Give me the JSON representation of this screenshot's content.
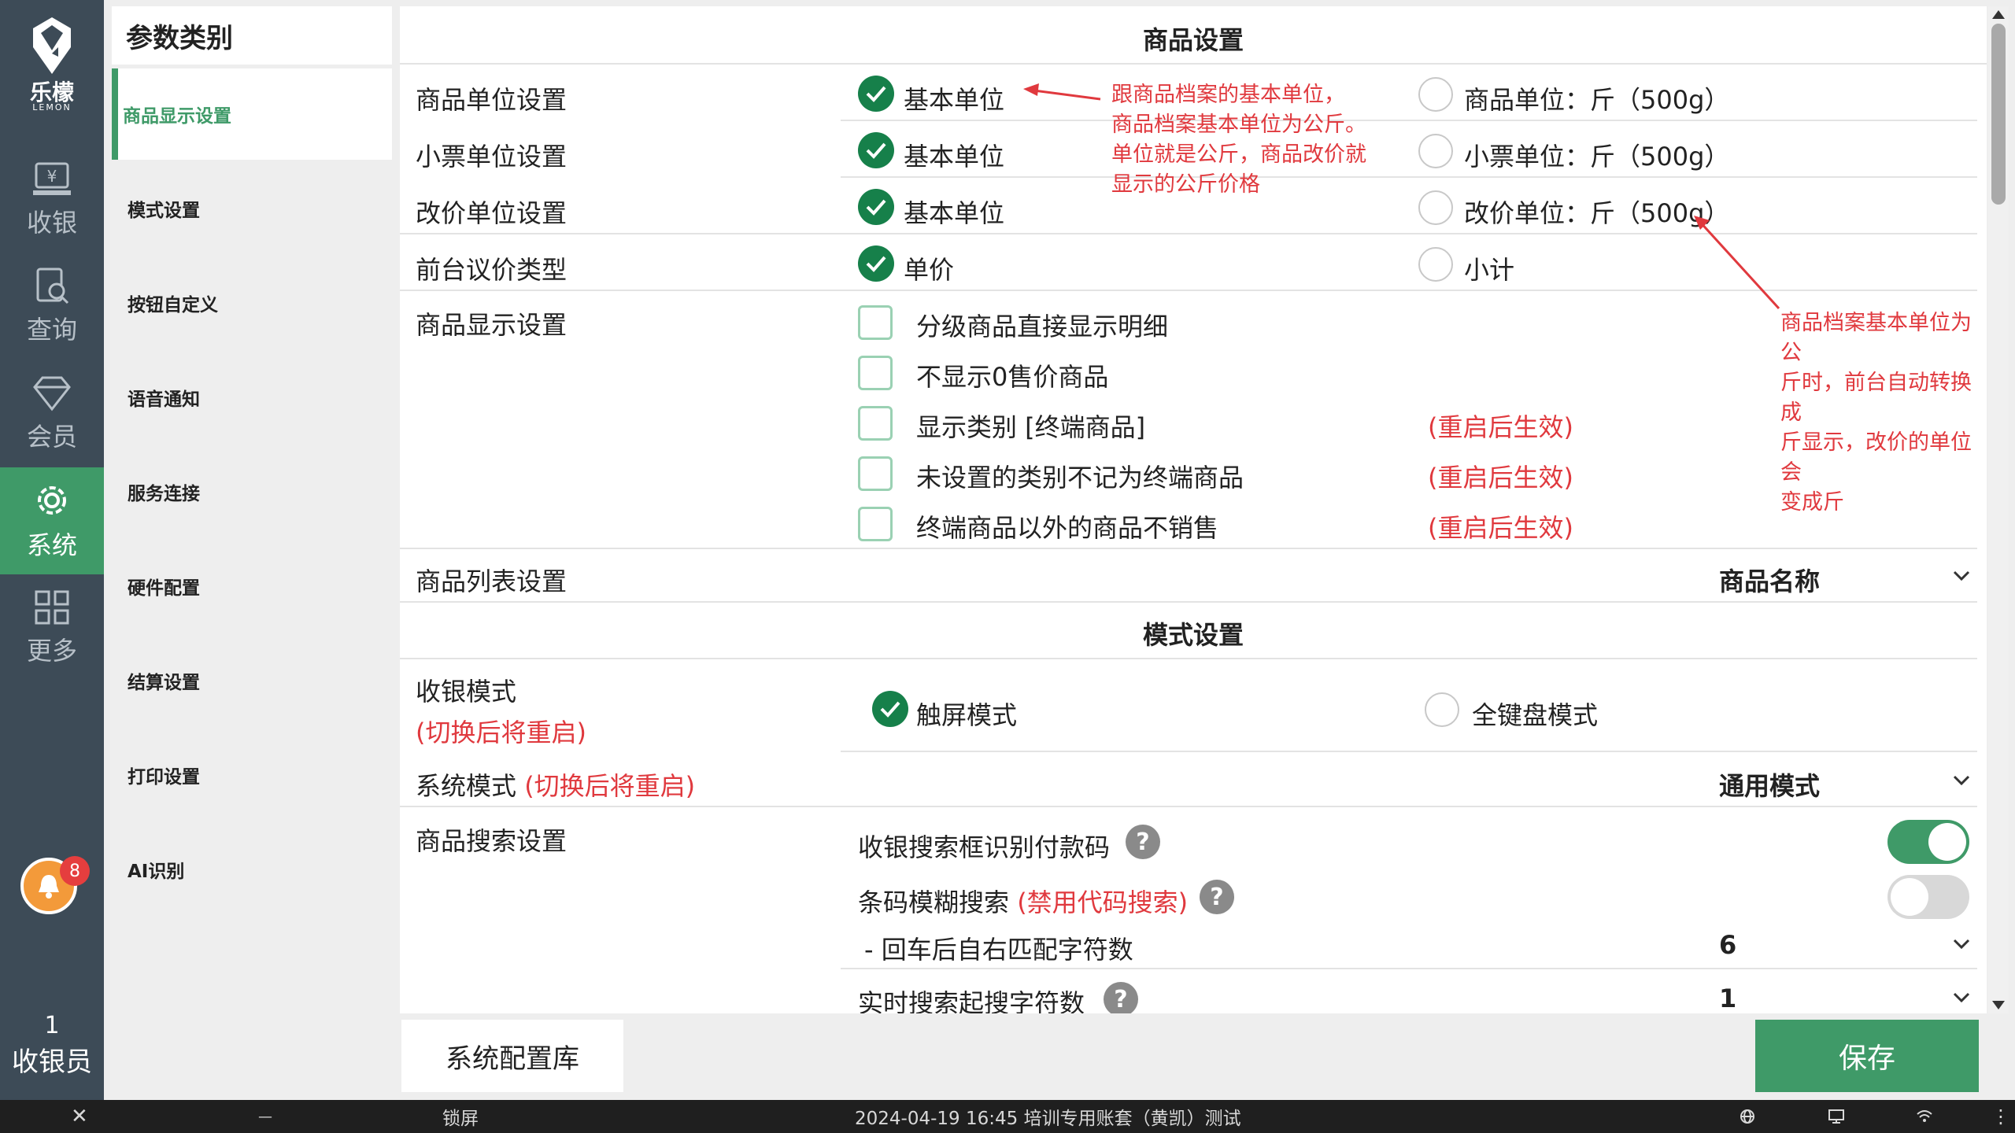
{
  "app": {
    "logo_cn": "乐檬",
    "logo_en": "LEMON"
  },
  "nav": {
    "items": [
      {
        "label": "收银",
        "icon": "cash-register-icon"
      },
      {
        "label": "查询",
        "icon": "search-doc-icon"
      },
      {
        "label": "会员",
        "icon": "diamond-icon"
      },
      {
        "label": "系统",
        "icon": "gear-icon"
      },
      {
        "label": "更多",
        "icon": "grid-icon"
      }
    ],
    "notify_count": "8",
    "user_number": "1",
    "user_role": "收银员"
  },
  "categories": {
    "header": "参数类别",
    "items": [
      "商品显示设置",
      "模式设置",
      "按钮自定义",
      "语音通知",
      "服务连接",
      "硬件配置",
      "结算设置",
      "打印设置",
      "AI识别"
    ]
  },
  "goods_section": {
    "title": "商品设置",
    "rows": [
      {
        "label": "商品单位设置",
        "opt1": "基本单位",
        "opt2": "商品单位：斤（500g）"
      },
      {
        "label": "小票单位设置",
        "opt1": "基本单位",
        "opt2": "小票单位：斤（500g）"
      },
      {
        "label": "改价单位设置",
        "opt1": "基本单位",
        "opt2": "改价单位：斤（500g）"
      },
      {
        "label": "前台议价类型",
        "opt1": "单价",
        "opt2": "小计"
      }
    ],
    "display_label": "商品显示设置",
    "display_options": [
      {
        "text": "分级商品直接显示明细",
        "note": ""
      },
      {
        "text": "不显示0售价商品",
        "note": ""
      },
      {
        "text": "显示类别 [终端商品]",
        "note": "(重启后生效)"
      },
      {
        "text": "未设置的类别不记为终端商品",
        "note": "(重启后生效)"
      },
      {
        "text": "终端商品以外的商品不销售",
        "note": "(重启后生效)"
      }
    ],
    "list_label": "商品列表设置",
    "list_value": "商品名称"
  },
  "annotations": {
    "note1": [
      "跟商品档案的基本单位，",
      "商品档案基本单位为公斤。",
      "单位就是公斤，商品改价就",
      "显示的公斤价格"
    ],
    "note2": [
      "商品档案基本单位为公",
      "斤时，前台自动转换成",
      "斤显示，改价的单位会",
      "变成斤"
    ]
  },
  "mode_section": {
    "title": "模式设置",
    "cash_mode_label": "收银模式",
    "cash_mode_note": "(切换后将重启)",
    "cash_mode_opt1": "触屏模式",
    "cash_mode_opt2": "全键盘模式",
    "sys_mode_label": "系统模式",
    "sys_mode_note": "(切换后将重启)",
    "sys_mode_value": "通用模式",
    "search_label": "商品搜索设置",
    "search_opt1": "收银搜索框识别付款码",
    "search_opt2": "条码模糊搜索",
    "search_opt2_note": "(禁用代码搜索)",
    "search_sub": "- 回车后自右匹配字符数",
    "search_sub_value": "6",
    "realtime_label": "实时搜索起搜字符数",
    "realtime_value": "1"
  },
  "toggles": {
    "search_opt1_on": true,
    "search_opt2_on": false
  },
  "buttons": {
    "sys_config": "系统配置库",
    "save": "保存"
  },
  "statusbar": {
    "close": "✕",
    "minimize": "—",
    "lock": "锁屏",
    "info": "2024-04-19 16:45 培训专用账套（黄凯）测试"
  },
  "colors": {
    "accent": "#3f9a68",
    "sidebar": "#3d4b57",
    "check": "#16804a",
    "red": "#e0393e"
  }
}
